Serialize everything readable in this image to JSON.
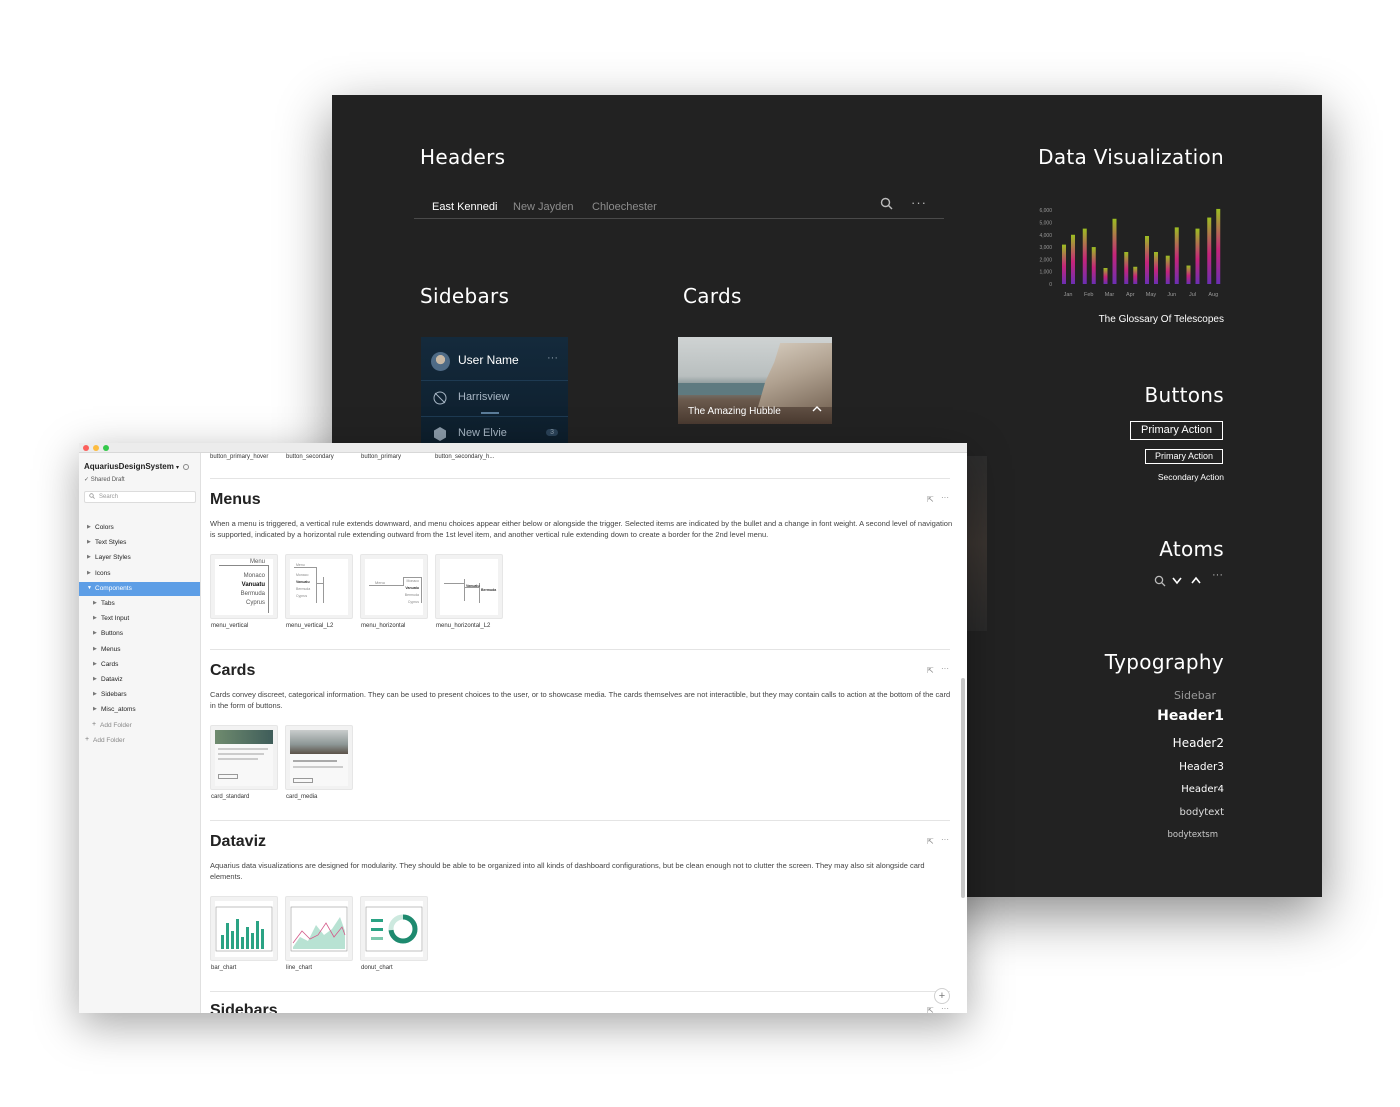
{
  "dark": {
    "headers": {
      "title": "Headers",
      "tabs": [
        "East Kennedi",
        "New Jayden",
        "Chloechester"
      ]
    },
    "sidebars": {
      "title": "Sidebars",
      "user_name": "User Name",
      "items": [
        "Harrisview",
        "New Elvie"
      ],
      "badge": "3"
    },
    "cards": {
      "title": "Cards",
      "caption": "The Amazing Hubble"
    },
    "dataviz": {
      "title": "Data Visualization",
      "caption": "The Glossary Of Telescopes"
    },
    "buttons": {
      "title": "Buttons",
      "primary_large": "Primary Action",
      "primary_small": "Primary Action",
      "secondary": "Secondary Action"
    },
    "atoms": {
      "title": "Atoms"
    },
    "typography": {
      "title": "Typography",
      "samples": [
        "Sidebar",
        "Header1",
        "Header2",
        "Header3",
        "Header4",
        "bodytext",
        "bodytextsm"
      ]
    }
  },
  "chart_data": {
    "type": "bar",
    "categories": [
      "Jan",
      "Feb",
      "Mar",
      "Apr",
      "May",
      "Jun",
      "Jul",
      "Aug"
    ],
    "series": [
      {
        "values": [
          3200,
          4500,
          1300,
          2600,
          3900,
          2300,
          1500,
          5400
        ]
      },
      {
        "values": [
          4000,
          3000,
          5300,
          1400,
          2600,
          4600,
          4500,
          6100
        ]
      }
    ],
    "y_ticks": [
      "6,000",
      "5,000",
      "4,000",
      "3,000",
      "2,000",
      "1,000",
      "0"
    ],
    "ylim": [
      0,
      6500
    ],
    "title": "The Glossary Of Telescopes",
    "colors": {
      "start": "#6b2fb3",
      "mid": "#c6247a",
      "end": "#9bbf21"
    }
  },
  "app": {
    "title": "AquariusDesignSystem",
    "draft": "Shared Draft",
    "search_placeholder": "Search",
    "tree": [
      {
        "label": "Colors",
        "level": 0
      },
      {
        "label": "Text Styles",
        "level": 0
      },
      {
        "label": "Layer Styles",
        "level": 0
      },
      {
        "label": "Icons",
        "level": 0
      },
      {
        "label": "Components",
        "level": 0,
        "selected": true
      },
      {
        "label": "Tabs",
        "level": 1
      },
      {
        "label": "Text Input",
        "level": 1
      },
      {
        "label": "Buttons",
        "level": 1
      },
      {
        "label": "Menus",
        "level": 1
      },
      {
        "label": "Cards",
        "level": 1
      },
      {
        "label": "Dataviz",
        "level": 1
      },
      {
        "label": "Sidebars",
        "level": 1
      },
      {
        "label": "Misc_atoms",
        "level": 1
      }
    ],
    "add_folder": "Add Folder",
    "top_labels": [
      "button_primary_hover",
      "button_secondary",
      "button_primary",
      "button_secondary_h..."
    ],
    "sections": {
      "menus": {
        "title": "Menus",
        "desc": "When a menu is triggered, a vertical rule extends downward, and menu choices appear either  below or alongside the trigger. Selected items are indicated by the bullet and a change in font weight.  A second level of navigation is supported, indicated by a horizontal rule extending outward from the 1st level item, and another vertical rule extending down to create a border for the 2nd level menu.",
        "thumbs": [
          "menu_vertical",
          "menu_vertical_L2",
          "menu_horizontal",
          "menu_horizontal_L2"
        ],
        "menu_items": [
          "Menu",
          "Monaco",
          "Vanuatu",
          "Bermuda",
          "Cyprus"
        ]
      },
      "cards": {
        "title": "Cards",
        "desc": "Cards convey discreet, categorical information. They can be used to present choices to the user, or to showcase media. The cards themselves are not interactible, but they may contain calls to action at the bottom of the card in the form of buttons.",
        "thumbs": [
          "card_standard",
          "card_media"
        ]
      },
      "dataviz": {
        "title": "Dataviz",
        "desc": "Aquarius data visualizations are designed for modularity. They should be able to be organized into all kinds of dashboard  configurations, but be clean enough not to clutter the screen.  They may also sit alongside card elements.",
        "thumbs": [
          "bar_chart",
          "line_chart",
          "donut_chart"
        ]
      },
      "sidebars": {
        "title": "Sidebars"
      }
    }
  }
}
